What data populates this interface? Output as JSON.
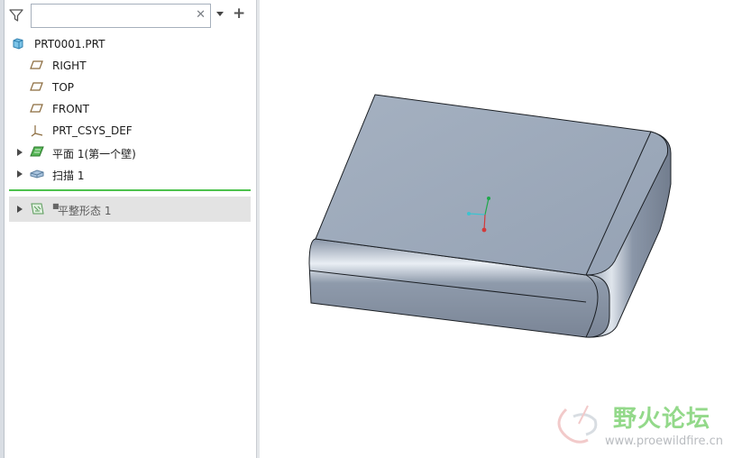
{
  "search": {
    "value": "",
    "placeholder": ""
  },
  "tree": {
    "root": {
      "label": "PRT0001.PRT",
      "icon": "part-icon"
    },
    "items": [
      {
        "label": "RIGHT",
        "icon": "datum-plane-icon"
      },
      {
        "label": "TOP",
        "icon": "datum-plane-icon"
      },
      {
        "label": "FRONT",
        "icon": "datum-plane-icon"
      },
      {
        "label": "PRT_CSYS_DEF",
        "icon": "coordinate-system-icon"
      },
      {
        "label": "平面 1(第一个壁)",
        "icon": "planar-wall-icon"
      },
      {
        "label": "扫描 1",
        "icon": "sweep-icon"
      }
    ],
    "inserted": {
      "label": "平整形态 1",
      "icon": "flat-state-icon"
    }
  },
  "watermark": {
    "text": "野火论坛",
    "url": "www.proewildfire.cn"
  },
  "colors": {
    "insert_line": "#4ec24e",
    "model_face": "#9aa7b8"
  }
}
